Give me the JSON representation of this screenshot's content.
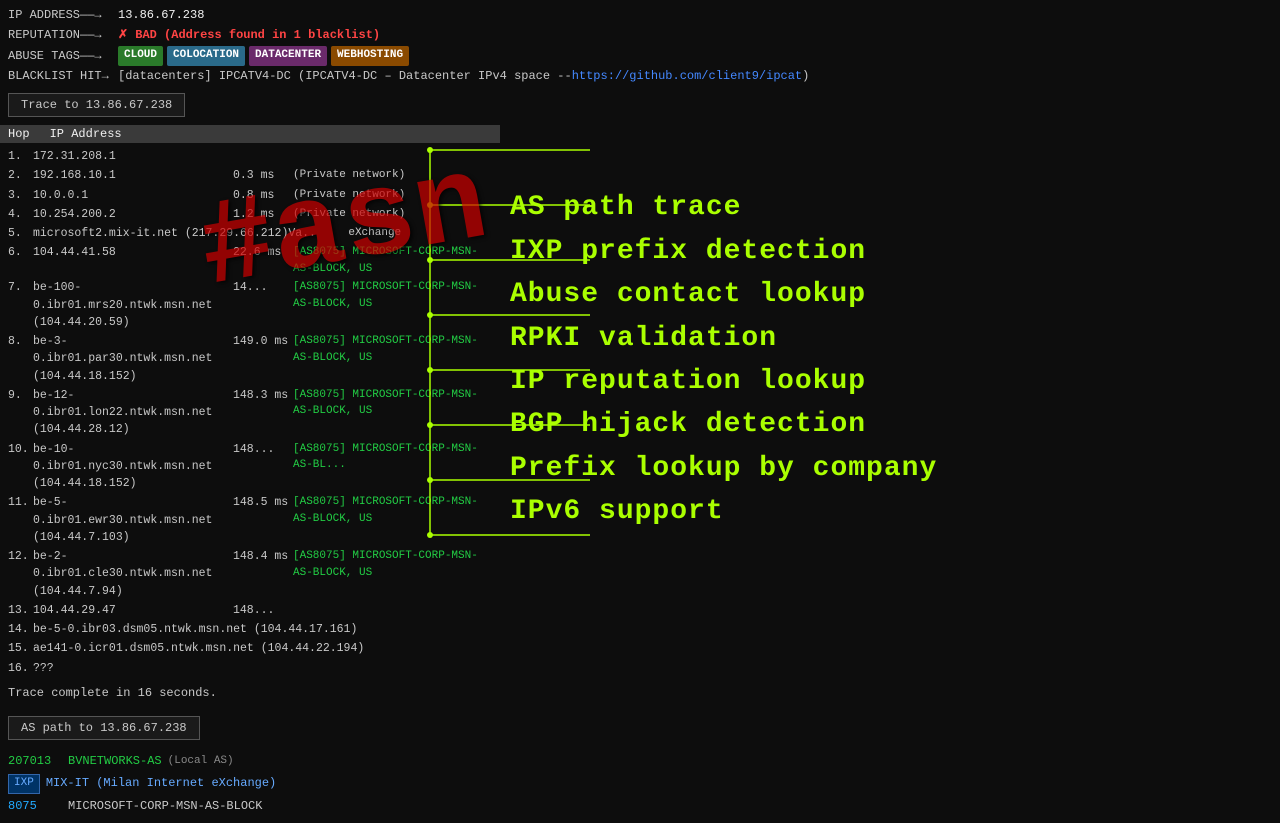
{
  "header": {
    "ip_label": "IP ADDRESS——→",
    "ip_value": "13.86.67.238",
    "rep_label": "REPUTATION——→",
    "rep_value": "✗  BAD (Address found in 1 blacklist)",
    "tags_label": "ABUSE TAGS——→",
    "tags": [
      "CLOUD",
      "COLOCATION",
      "DATACENTER",
      "WEBHOSTING"
    ],
    "blacklist_label": "BLACKLIST HIT→",
    "blacklist_value": "[datacenters] IPCATV4-DC (IPCATV4-DC – Datacenter IPv4 space -- ",
    "blacklist_link": "https://github.com/client9/ipcat",
    "blacklist_end": ")"
  },
  "trace": {
    "button_label": "Trace to 13.86.67.238",
    "table_headers": [
      "Hop",
      "IP Address"
    ],
    "hops": [
      {
        "num": "1.",
        "ip": "172.31.208.1",
        "ms": "",
        "asn": ""
      },
      {
        "num": "2.",
        "ip": "192.168.10.1",
        "ms": "0.3 ms",
        "asn": "(Private network)"
      },
      {
        "num": "3.",
        "ip": "10.0.0.1",
        "ms": "0.8 ms",
        "asn": "(Private network)"
      },
      {
        "num": "4.",
        "ip": "10.254.200.2",
        "ms": "1.2 ms",
        "asn": "(Private network)"
      },
      {
        "num": "5.",
        "ip": "microsoft2.mix-it.net (217.29.66.212)",
        "ms": "Va..",
        "asn": "eXchange",
        "link": true
      },
      {
        "num": "6.",
        "ip": "104.44.41.58",
        "ms": "22.6 ms",
        "asn": "[AS8075] MICROSOFT-CORP-MSN-AS-BLOCK, US",
        "asn_green": true
      },
      {
        "num": "7.",
        "ip": "be-100-0.ibr01.mrs20.ntwk.msn.net (104.44.20.59)",
        "ms": "14...",
        "asn": "[AS8075] MICROSOFT-CORP-MSN-AS-BLOCK, US",
        "asn_green": true
      },
      {
        "num": "8.",
        "ip": "be-3-0.ibr01.par30.ntwk.msn.net (104.44.18.152)",
        "ms": "149.0 ms",
        "asn": "[AS8075] MICROSOFT-CORP-MSN-AS-BLOCK, US",
        "asn_green": true
      },
      {
        "num": "9.",
        "ip": "be-12-0.ibr01.lon22.ntwk.msn.net (104.44.28.12)",
        "ms": "148.3 ms",
        "asn": "[AS8075] MICROSOFT-CORP-MSN-AS-BLOCK, US",
        "asn_green": true
      },
      {
        "num": "10.",
        "ip": "be-10-0.ibr01.nyc30.ntwk.msn.net (104.44.18.152)",
        "ms": "148...",
        "asn": "[AS8075] MICROSOFT-CORP-MSN-AS-BL...",
        "asn_green": true
      },
      {
        "num": "11.",
        "ip": "be-5-0.ibr01.ewr30.ntwk.msn.net (104.44.7.103)",
        "ms": "148.5 ms",
        "asn": "[AS8075] MICROSOFT-CORP-MSN-AS-BLOCK, US",
        "asn_green": true
      },
      {
        "num": "12.",
        "ip": "be-2-0.ibr01.cle30.ntwk.msn.net (104.44.7.94)",
        "ms": "148.4 ms",
        "asn": "[AS8075] MICROSOFT-CORP-MSN-AS-BLOCK, US",
        "asn_green": true
      },
      {
        "num": "13.",
        "ip": "104.44.29.47",
        "ms": "148...",
        "asn": "",
        "asn_green": false
      },
      {
        "num": "14.",
        "ip": "be-5-0.ibr03.dsm05.ntwk.msn.net (104.44.17.161)",
        "ms": "",
        "asn": ""
      },
      {
        "num": "15.",
        "ip": "ae141-0.icr01.dsm05.ntwk.msn.net (104.44.22.194)",
        "ms": "",
        "asn": ""
      },
      {
        "num": "16.",
        "ip": "???",
        "ms": "",
        "asn": ""
      }
    ],
    "complete_text": "Trace complete in 16 seconds."
  },
  "as_path": {
    "button_label": "AS path to 13.86.67.238",
    "entries": [
      {
        "num": "207013",
        "name": "BVNETWORKS-AS",
        "extra": "(Local AS)",
        "type": "local"
      },
      {
        "badge": "IXP",
        "name": "MIX-IT (Milan Internet eXchange)",
        "type": "ixp"
      },
      {
        "num": "8075",
        "name": "MICROSOFT-CORP-MSN-AS-BLOCK",
        "type": "asn"
      }
    ]
  },
  "features": [
    "AS path trace",
    "IXP prefix detection",
    "Abuse contact lookup",
    "RPKI validation",
    "IP reputation lookup",
    "BGP hijack detection",
    "Prefix lookup by company",
    "IPv6 support"
  ],
  "watermark": "#asn",
  "colors": {
    "green": "#aaff00",
    "red": "#cc0000",
    "blue": "#4488ff",
    "asn_green": "#22cc44"
  }
}
